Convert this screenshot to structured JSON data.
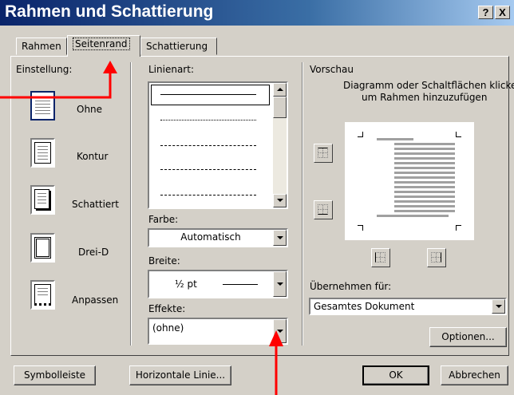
{
  "window": {
    "title": "Rahmen und Schattierung",
    "help_button": "?",
    "close_button": "X"
  },
  "tabs": [
    {
      "label": "Rahmen",
      "active": false
    },
    {
      "label": "Seitenrand",
      "active": true
    },
    {
      "label": "Schattierung",
      "active": false
    }
  ],
  "settings": {
    "heading": "Einstellung:",
    "items": [
      {
        "label": "Ohne",
        "icon": "none-border-icon"
      },
      {
        "label": "Kontur",
        "icon": "box-border-icon"
      },
      {
        "label": "Schattiert",
        "icon": "shadow-border-icon"
      },
      {
        "label": "Drei-D",
        "icon": "3d-border-icon"
      },
      {
        "label": "Anpassen",
        "icon": "custom-border-icon"
      }
    ]
  },
  "line_style": {
    "heading": "Linienart:",
    "options": [
      "solid",
      "dotted",
      "dashed",
      "dashed-wide",
      "dash-dot"
    ],
    "selected_index": 0
  },
  "color": {
    "label": "Farbe:",
    "value": "Automatisch"
  },
  "width": {
    "label": "Breite:",
    "value": "½ pt"
  },
  "effects": {
    "label": "Effekte:",
    "value": "(ohne)"
  },
  "preview": {
    "heading": "Vorschau",
    "instruction_line1": "Diagramm oder Schaltflächen klicken,",
    "instruction_line2": "um Rahmen hinzuzufügen"
  },
  "apply_to": {
    "label": "Übernehmen für:",
    "value": "Gesamtes Dokument"
  },
  "buttons": {
    "options": "Optionen...",
    "toolbar": "Symbolleiste",
    "horizontal_line": "Horizontale Linie...",
    "ok": "OK",
    "cancel": "Abbrechen"
  },
  "annotation_color": "#ff0000",
  "title_gradient": [
    "#0a246a",
    "#a6caf0"
  ]
}
